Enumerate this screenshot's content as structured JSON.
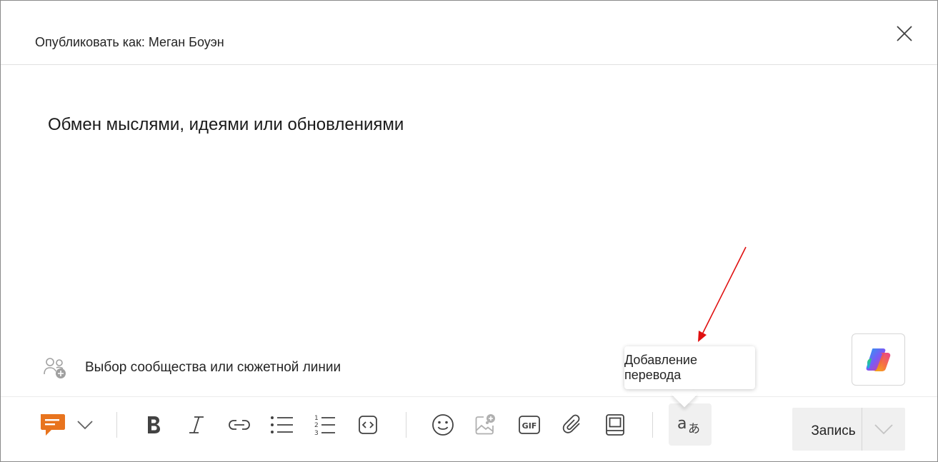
{
  "header": {
    "title": "Опубликовать как: Меган Боуэн"
  },
  "editor": {
    "placeholder": "Обмен мыслями, идеями или обновлениями"
  },
  "community": {
    "label": "Выбор сообщества или сюжетной линии"
  },
  "tooltip": {
    "text": "Добавление перевода"
  },
  "toolbar": {
    "post_type_icon": "discussion-icon",
    "items": [
      "bold-icon",
      "italic-icon",
      "link-icon",
      "bullet-list-icon",
      "numbered-list-icon",
      "code-icon",
      "emoji-icon",
      "image-icon",
      "gif-icon",
      "attach-icon",
      "template-icon",
      "translate-icon"
    ],
    "gif_label": "GIF",
    "translate_label_a": "a",
    "translate_label_b": "あ"
  },
  "post_button": {
    "label": "Запись"
  },
  "colors": {
    "accent_orange": "#e8741e",
    "annotation_red": "#e01010"
  }
}
